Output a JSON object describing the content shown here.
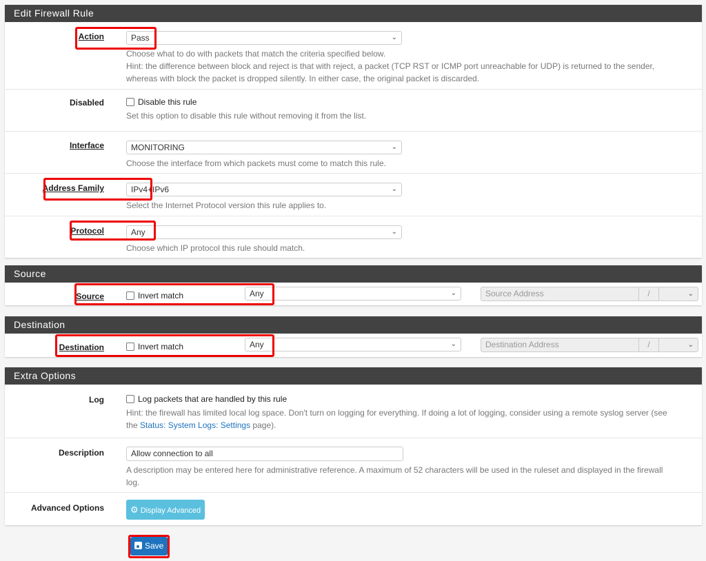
{
  "edit_panel": {
    "title": "Edit Firewall Rule",
    "action": {
      "label": "Action",
      "value": "Pass",
      "help1": "Choose what to do with packets that match the criteria specified below.",
      "help2": "Hint: the difference between block and reject is that with reject, a packet (TCP RST or ICMP port unreachable for UDP) is returned to the sender,",
      "help3": "whereas with block the packet is dropped silently. In either case, the original packet is discarded."
    },
    "disabled": {
      "label": "Disabled",
      "checkbox_label": "Disable this rule",
      "help": "Set this option to disable this rule without removing it from the list."
    },
    "interface": {
      "label": "Interface",
      "value": "MONITORING",
      "help": "Choose the interface from which packets must come to match this rule."
    },
    "address_family": {
      "label": "Address Family",
      "value": "IPv4+IPv6",
      "help": "Select the Internet Protocol version this rule applies to."
    },
    "protocol": {
      "label": "Protocol",
      "value": "Any",
      "help": "Choose which IP protocol this rule should match."
    }
  },
  "source_panel": {
    "title": "Source",
    "label": "Source",
    "invert_label": "Invert match",
    "value": "Any",
    "address_placeholder": "Source Address",
    "slash": "/"
  },
  "destination_panel": {
    "title": "Destination",
    "label": "Destination",
    "invert_label": "Invert match",
    "value": "Any",
    "address_placeholder": "Destination Address",
    "slash": "/"
  },
  "extra_panel": {
    "title": "Extra Options",
    "log": {
      "label": "Log",
      "checkbox_label": "Log packets that are handled by this rule",
      "help_line1": "Hint: the firewall has limited local log space. Don't turn on logging for everything. If doing a lot of logging, consider using a remote syslog server (see",
      "help_prefix": "the ",
      "help_link": "Status: System Logs: Settings",
      "help_suffix": " page)."
    },
    "description": {
      "label": "Description",
      "value": "Allow connection to all",
      "help1": "A description may be entered here for administrative reference. A maximum of 52 characters will be used in the ruleset and displayed in the firewall",
      "help2": "log."
    },
    "advanced": {
      "label": "Advanced Options",
      "button_label": "Display Advanced"
    }
  },
  "save_button": {
    "label": "Save"
  },
  "colors": {
    "header_bg": "#424242",
    "highlight": "#ee0000",
    "primary": "#1e73be",
    "info": "#5bc0de",
    "link": "#1e73be"
  }
}
